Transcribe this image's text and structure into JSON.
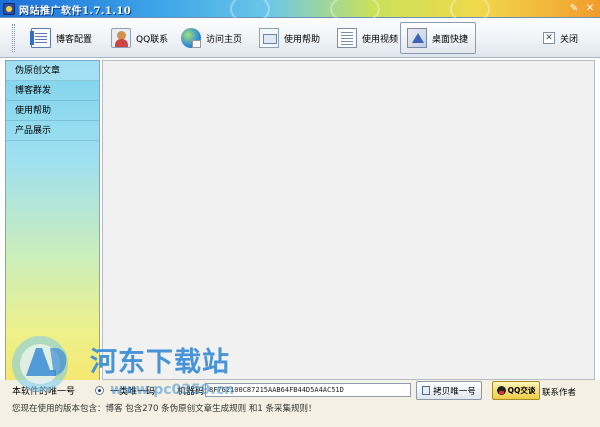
{
  "window": {
    "title": "网站推广软件1.7.1.10",
    "controls": [
      "pin-icon",
      "close-icon"
    ]
  },
  "toolbar": {
    "items": [
      {
        "label": "博客配置",
        "icon": "blog-doc-icon"
      },
      {
        "label": "QQ联系",
        "icon": "qq-contact-icon"
      },
      {
        "label": "访问主页",
        "icon": "globe-icon"
      },
      {
        "label": "使用帮助",
        "icon": "help-icon"
      },
      {
        "label": "使用视频",
        "icon": "video-icon"
      },
      {
        "label": "桌面快捷",
        "icon": "desktop-shortcut-icon"
      }
    ],
    "close_label": "关闭"
  },
  "sidebar": {
    "items": [
      {
        "label": "伪原创文章"
      },
      {
        "label": "博客群发"
      },
      {
        "label": "使用帮助"
      },
      {
        "label": "产品展示"
      }
    ]
  },
  "status": {
    "machine_label": "本软件的唯一号",
    "radio_option": "一类唯一码",
    "code_label": "机器码",
    "machine_code": "8F762100C87215AAB64FB44D5A4AC51D",
    "copy_button": "拷贝唯一号",
    "qq_button": "QQ交谈",
    "contact_label": "联系作者",
    "info_line": "您现在使用的版本包含：博客  包含270 条伪原创文章生成规则  和1 条采集规则！"
  },
  "watermark": {
    "site_name": "河东下载站",
    "url": "www.pc0359.cn"
  }
}
